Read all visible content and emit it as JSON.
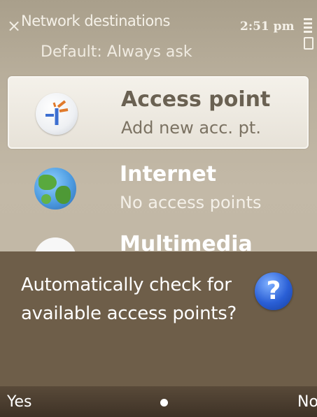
{
  "header": {
    "title": "Network destinations",
    "subtitle": "Default: Always ask",
    "time": "2:51 pm",
    "close_icon": "close-icon",
    "battery_icon": "battery-icon"
  },
  "list": [
    {
      "title": "Access point",
      "subtitle": "Add new acc. pt.",
      "icon": "access-point-icon"
    },
    {
      "title": "Internet",
      "subtitle": "No access points",
      "icon": "globe-icon"
    },
    {
      "title": "Multimedia msg",
      "subtitle": "",
      "icon": "mms-icon"
    }
  ],
  "dialog": {
    "message": "Automatically check for available access points?",
    "icon": "help-icon",
    "icon_glyph": "?",
    "accent": "#2a5fd6"
  },
  "softkeys": {
    "left": "Yes",
    "right": "No"
  },
  "colors": {
    "dialog_bg": "#6e5e49",
    "softkey_bg": "#4a3d2f"
  }
}
